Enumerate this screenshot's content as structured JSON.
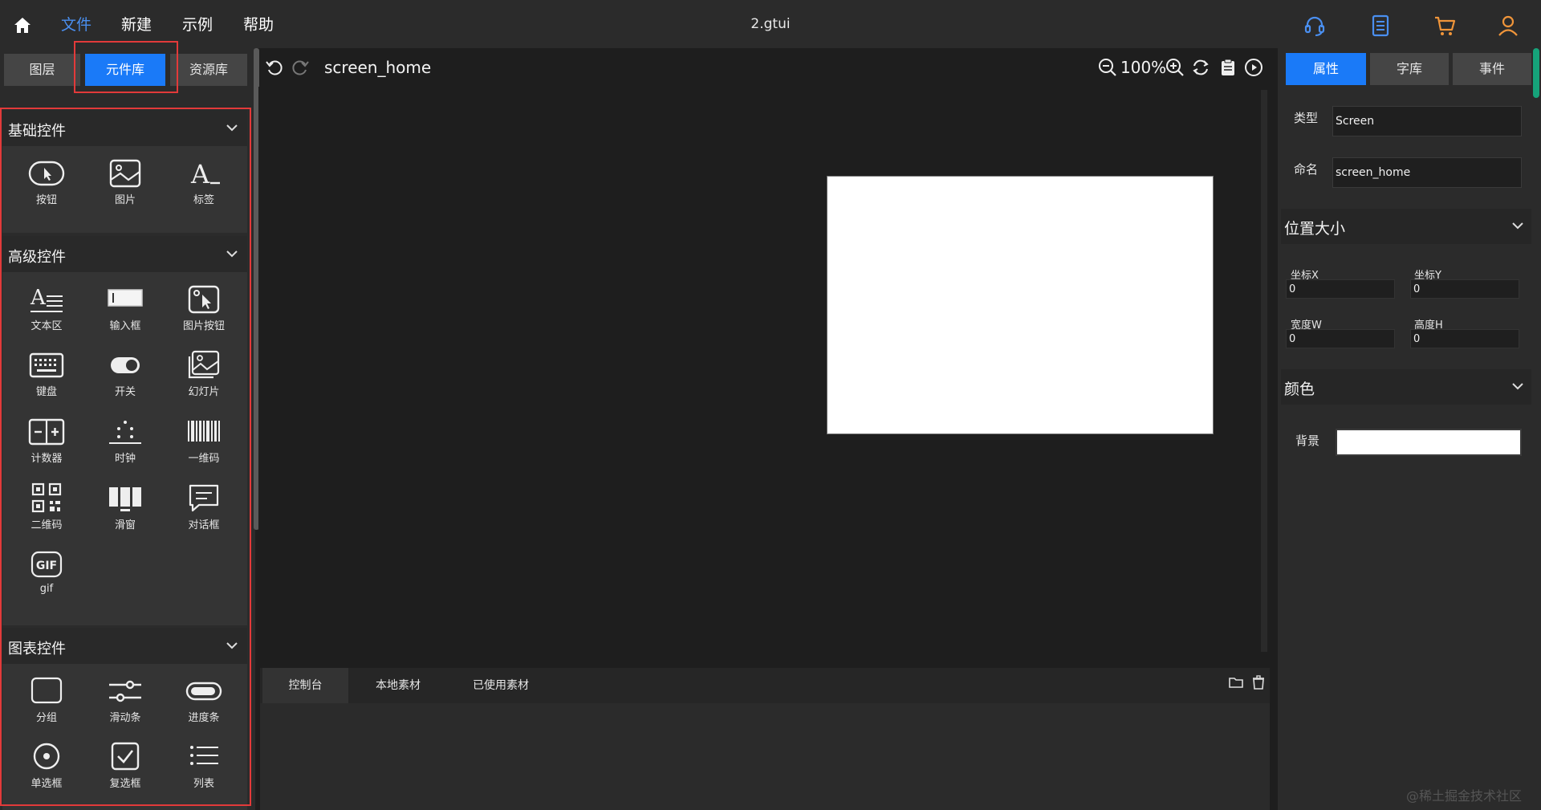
{
  "menubar": {
    "items": [
      "文件",
      "新建",
      "示例",
      "帮助"
    ],
    "active_index": 0,
    "title": "2.gtui"
  },
  "left_panel": {
    "tabs": [
      "图层",
      "元件库",
      "资源库"
    ],
    "active_tab": 1,
    "sections": [
      {
        "title": "基础控件",
        "widgets": [
          {
            "label": "按钮",
            "icon": "button-icon"
          },
          {
            "label": "图片",
            "icon": "image-icon"
          },
          {
            "label": "标签",
            "icon": "label-icon"
          }
        ]
      },
      {
        "title": "高级控件",
        "widgets": [
          {
            "label": "文本区",
            "icon": "textarea-icon"
          },
          {
            "label": "输入框",
            "icon": "input-box-icon"
          },
          {
            "label": "图片按钮",
            "icon": "image-button-icon"
          },
          {
            "label": "键盘",
            "icon": "keyboard-icon"
          },
          {
            "label": "开关",
            "icon": "switch-icon"
          },
          {
            "label": "幻灯片",
            "icon": "slideshow-icon"
          },
          {
            "label": "计数器",
            "icon": "counter-icon"
          },
          {
            "label": "时钟",
            "icon": "clock-icon"
          },
          {
            "label": "一维码",
            "icon": "barcode-icon"
          },
          {
            "label": "二维码",
            "icon": "qrcode-icon"
          },
          {
            "label": "滑窗",
            "icon": "sliding-window-icon"
          },
          {
            "label": "对话框",
            "icon": "dialog-icon"
          },
          {
            "label": "gif",
            "icon": "gif-icon"
          }
        ]
      },
      {
        "title": "图表控件",
        "widgets": [
          {
            "label": "分组",
            "icon": "group-icon"
          },
          {
            "label": "滑动条",
            "icon": "slider-icon"
          },
          {
            "label": "进度条",
            "icon": "progressbar-icon"
          },
          {
            "label": "单选框",
            "icon": "radio-icon"
          },
          {
            "label": "复选框",
            "icon": "checkbox-icon"
          },
          {
            "label": "列表",
            "icon": "list-icon"
          }
        ]
      }
    ]
  },
  "canvas": {
    "screen_name": "screen_home",
    "zoom": "100%"
  },
  "console": {
    "tabs": [
      "控制台",
      "本地素材",
      "已使用素材"
    ],
    "active_tab": 0
  },
  "right_panel": {
    "tabs": [
      "属性",
      "字库",
      "事件"
    ],
    "active_tab": 0,
    "type_label": "类型",
    "type_value": "Screen",
    "name_label": "命名",
    "name_value": "screen_home",
    "position_group": {
      "title": "位置大小",
      "x_label": "坐标X",
      "x_value": "0",
      "y_label": "坐标Y",
      "y_value": "0",
      "w_label": "宽度W",
      "w_value": "0",
      "h_label": "高度H",
      "h_value": "0"
    },
    "color_group": {
      "title": "颜色",
      "bg_label": "背景",
      "bg_value": "#ffffff"
    }
  },
  "watermark": "@稀土掘金技术社区",
  "colors": {
    "accent": "#1a7af8",
    "menu_active": "#4a8ff0",
    "highlight_border": "#e23a3a",
    "panel_bg": "#2b2b2b",
    "canvas_bg": "#1e1e1e"
  }
}
